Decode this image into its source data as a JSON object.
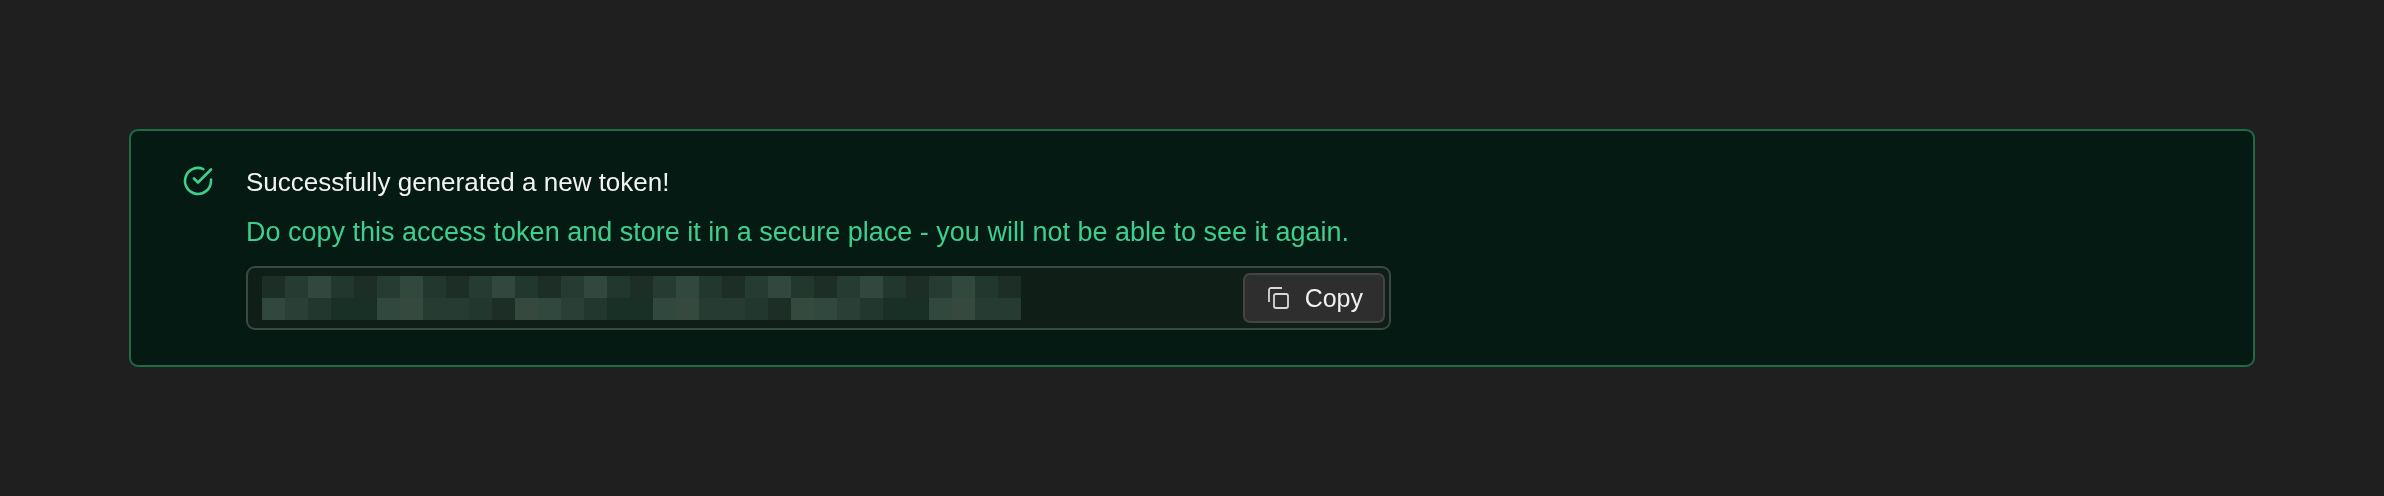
{
  "alert": {
    "title": "Successfully generated a new token!",
    "message": "Do copy this access token and store it in a secure place - you will not be able to see it again.",
    "token_field": {
      "copy_button": "Copy"
    }
  }
}
